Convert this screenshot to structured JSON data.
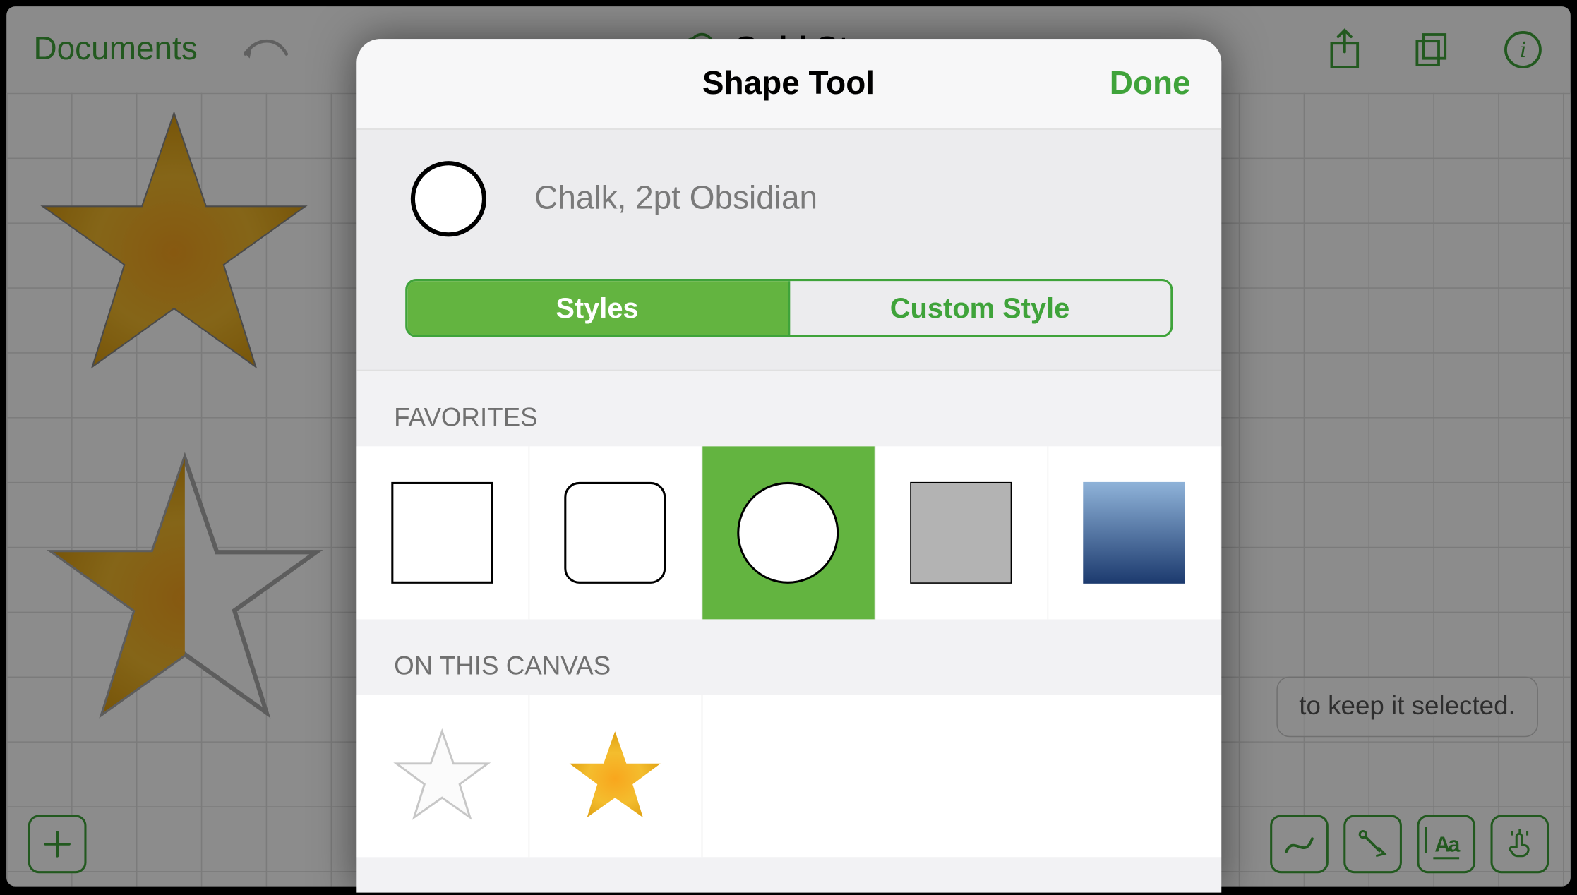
{
  "topbar": {
    "documents": "Documents",
    "title": "Gold Stars"
  },
  "hint": "to keep it selected.",
  "popover": {
    "title": "Shape Tool",
    "done": "Done",
    "preview_label": "Chalk, 2pt Obsidian",
    "tabs": {
      "styles": "Styles",
      "custom": "Custom Style"
    },
    "favorites_header": "FAVORITES",
    "canvas_header": "ON THIS CANVAS",
    "favorites": [
      {
        "name": "square",
        "type": "square",
        "selected": false
      },
      {
        "name": "rounded-square",
        "type": "rsquare",
        "selected": false
      },
      {
        "name": "circle",
        "type": "circle",
        "selected": true
      },
      {
        "name": "gray-square",
        "type": "gray",
        "selected": false
      },
      {
        "name": "blue-gradient-square",
        "type": "blue",
        "selected": false
      }
    ],
    "on_canvas": [
      {
        "name": "white-star"
      },
      {
        "name": "gold-star"
      }
    ]
  },
  "colors": {
    "accent": "#3fa33a"
  }
}
